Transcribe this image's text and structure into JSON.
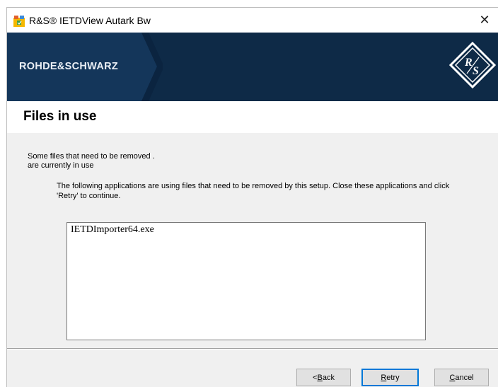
{
  "window": {
    "title": "R&S® IETDView Autark Bw",
    "close_glyph": "✕"
  },
  "banner": {
    "brand": "ROHDE&SCHWARZ",
    "logo_text": "R&S",
    "colors": {
      "background": "#0e2a47"
    }
  },
  "page": {
    "title": "Files in use",
    "message_line1": "Some files that need to be removed .",
    "message_line2": "are currently in use",
    "instructions": "The following applications are using files that need to be removed by this setup. Close these applications and click 'Retry' to continue."
  },
  "app_list": {
    "items": [
      "IETDImporter64.exe"
    ]
  },
  "buttons": {
    "back": {
      "prefix": "< ",
      "mnemonic": "B",
      "rest": "ack"
    },
    "retry": {
      "mnemonic": "R",
      "rest": "etry"
    },
    "cancel": {
      "mnemonic": "C",
      "rest": "ancel"
    }
  },
  "colors": {
    "accent": "#0078d7"
  }
}
